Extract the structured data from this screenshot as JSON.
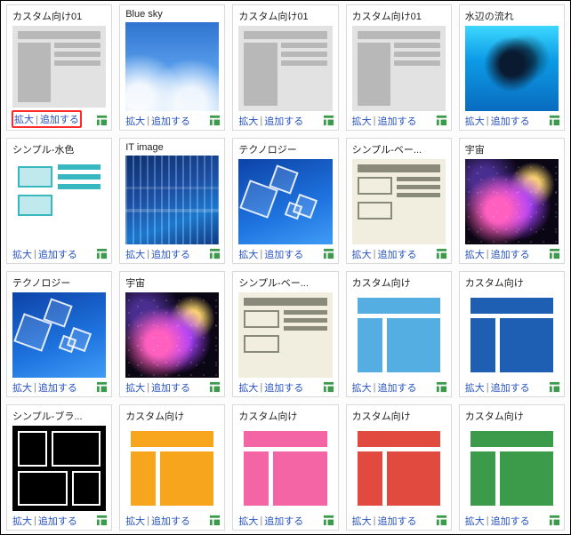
{
  "labels": {
    "zoom": "拡大",
    "add": "追加する",
    "separator": "|"
  },
  "highlight_index": 0,
  "cards": [
    {
      "title": "カスタム向け01",
      "thumb": "ph-gray"
    },
    {
      "title": "Blue sky",
      "thumb": "ph-bluesky"
    },
    {
      "title": "カスタム向け01",
      "thumb": "ph-gray"
    },
    {
      "title": "カスタム向け01",
      "thumb": "ph-gray"
    },
    {
      "title": "水辺の流れ",
      "thumb": "ph-water"
    },
    {
      "title": "シンプル-水色",
      "thumb": "ph-simple-aqua"
    },
    {
      "title": "IT image",
      "thumb": "ph-it"
    },
    {
      "title": "テクノロジー",
      "thumb": "ph-tech"
    },
    {
      "title": "シンプル-ベー...",
      "thumb": "ph-simple-beige"
    },
    {
      "title": "宇宙",
      "thumb": "ph-space"
    },
    {
      "title": "テクノロジー",
      "thumb": "ph-tech"
    },
    {
      "title": "宇宙",
      "thumb": "ph-space"
    },
    {
      "title": "シンプル-ベー...",
      "thumb": "ph-simple-beige"
    },
    {
      "title": "カスタム向け",
      "thumb": "ph-layout c-ltblue"
    },
    {
      "title": "カスタム向け",
      "thumb": "ph-layout c-dkblue"
    },
    {
      "title": "シンプル-ブラ...",
      "thumb": "ph-black"
    },
    {
      "title": "カスタム向け",
      "thumb": "ph-layout c-orange"
    },
    {
      "title": "カスタム向け",
      "thumb": "ph-layout c-pink"
    },
    {
      "title": "カスタム向け",
      "thumb": "ph-layout c-red"
    },
    {
      "title": "カスタム向け",
      "thumb": "ph-layout c-green"
    }
  ]
}
